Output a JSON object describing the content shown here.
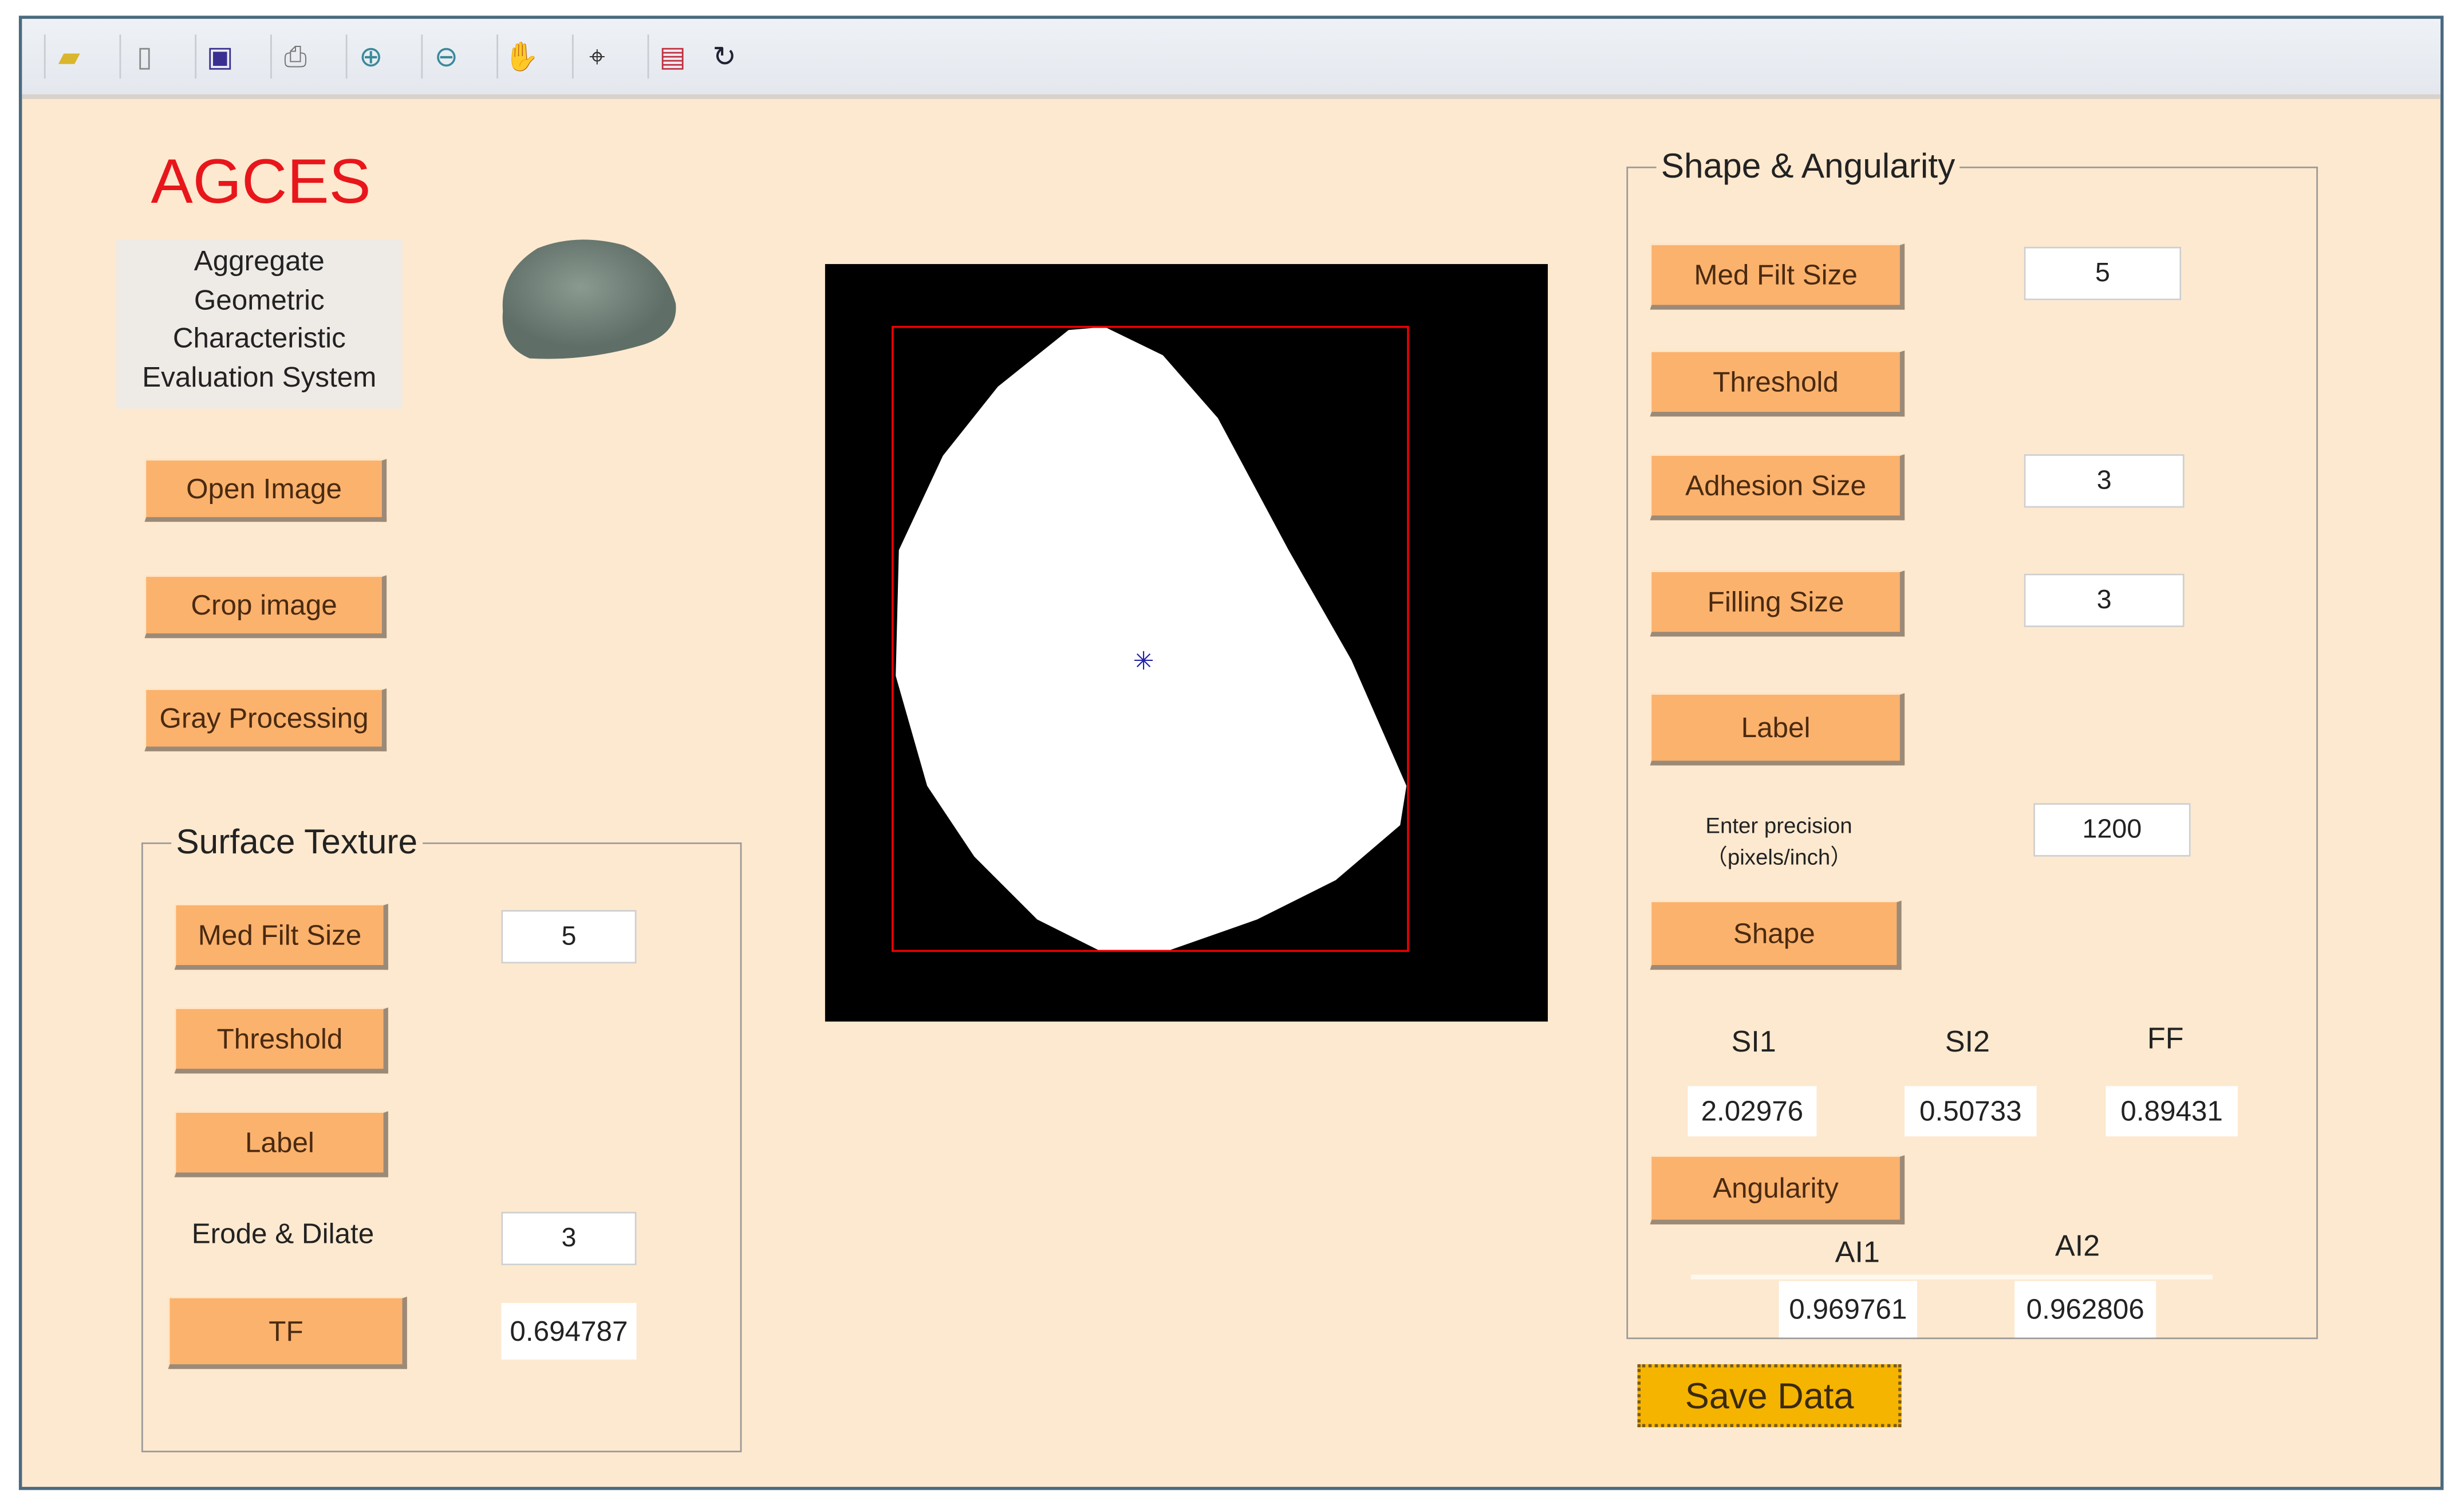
{
  "toolbar": {
    "icons": [
      "open-folder-icon",
      "new-file-icon",
      "save-icon",
      "print-icon",
      "zoom-in-icon",
      "zoom-out-icon",
      "pan-hand-icon",
      "data-cursor-icon",
      "colorbar-icon",
      "rotate-3d-icon"
    ]
  },
  "app": {
    "title": "AGCES",
    "subtitle_lines": [
      "Aggregate",
      "Geometric",
      "Characteristic",
      "Evaluation System"
    ]
  },
  "left_buttons": {
    "open": "Open Image",
    "crop": "Crop image",
    "gray": "Gray Processing"
  },
  "surface": {
    "title": "Surface Texture",
    "med_filt": "Med Filt Size",
    "med_filt_value": "5",
    "threshold": "Threshold",
    "label": "Label",
    "erode_label": "Erode & Dilate",
    "erode_value": "3",
    "tf": "TF",
    "tf_value": "0.694787"
  },
  "shape": {
    "title": "Shape & Angularity",
    "med_filt": "Med Filt Size",
    "med_filt_value": "5",
    "threshold": "Threshold",
    "adhesion": "Adhesion Size",
    "adhesion_value": "3",
    "filling": "Filling Size",
    "filling_value": "3",
    "label": "Label",
    "precision_label_1": "Enter precision",
    "precision_label_2": "（pixels/inch）",
    "precision_value": "1200",
    "shape_btn": "Shape",
    "si1": "SI1",
    "si2": "SI2",
    "ff": "FF",
    "si1_value": "2.02976",
    "si2_value": "0.50733",
    "ff_value": "0.89431",
    "angularity_btn": "Angularity",
    "ai1": "AI1",
    "ai2": "AI2",
    "ai1_value": "0.969761",
    "ai2_value": "0.962806"
  },
  "save": "Save Data",
  "colors": {
    "background": "#fde9cf",
    "button": "#fbb26d",
    "save": "#f5b400",
    "title": "#e8161b"
  }
}
